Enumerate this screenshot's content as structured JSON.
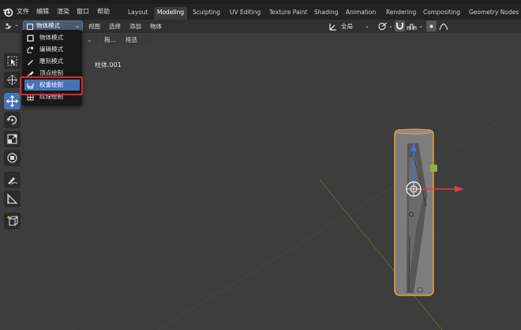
{
  "menu": {
    "items": [
      "文件",
      "编辑",
      "渲染",
      "窗口",
      "帮助"
    ]
  },
  "workspaces": [
    "Layout",
    "Modeling",
    "Sculpting",
    "UV Editing",
    "Texture Paint",
    "Shading",
    "Animation",
    "Rendering",
    "Compositing",
    "Geometry Nodes"
  ],
  "active_workspace": "Modeling",
  "header": {
    "mode_label": "物体模式",
    "view": "视图",
    "select": "选择",
    "add": "添加",
    "object": "物体",
    "transform_orientation": "全局"
  },
  "row2": {
    "drag": "拖...",
    "select_mode": "框选"
  },
  "viewport": {
    "object_label": "柱体.001"
  },
  "mode_dropdown": {
    "items": [
      {
        "label": "物体模式",
        "icon": "object-mode-icon"
      },
      {
        "label": "编辑模式",
        "icon": "edit-mode-icon"
      },
      {
        "label": "雕刻模式",
        "icon": "sculpt-mode-icon"
      },
      {
        "label": "顶点绘制",
        "icon": "vertex-paint-icon"
      },
      {
        "label": "权重绘制",
        "icon": "weight-paint-icon"
      },
      {
        "label": "纹理绘制",
        "icon": "texture-paint-icon"
      }
    ],
    "highlighted": "权重绘制"
  },
  "colors": {
    "accent": "#4772b3",
    "highlight_box": "#e0222e",
    "selection_outline": "#f0a030",
    "gizmo_x": "#e03c4a",
    "gizmo_z": "#3a78e0"
  }
}
